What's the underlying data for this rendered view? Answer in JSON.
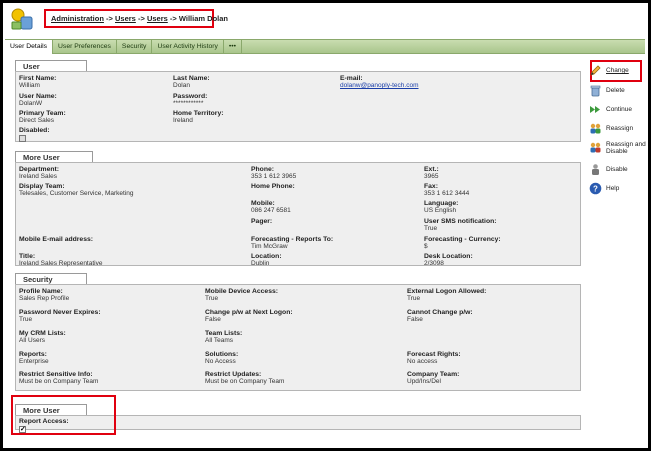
{
  "breadcrumb": {
    "items": [
      "Administration",
      "Users",
      "Users"
    ],
    "separator": "->",
    "current": "William Dolan"
  },
  "tabs": [
    "User Details",
    "User Preferences",
    "Security",
    "User Activity History",
    "•••"
  ],
  "user": {
    "title": "User",
    "first_name_label": "First Name:",
    "first_name": "William",
    "last_name_label": "Last Name:",
    "last_name": "Dolan",
    "email_label": "E-mail:",
    "email": "dolanw@panoply-tech.com",
    "username_label": "User Name:",
    "username": "DolanW",
    "password_label": "Password:",
    "password": "************",
    "primary_team_label": "Primary Team:",
    "primary_team": "Direct Sales",
    "home_territory_label": "Home Territory:",
    "home_territory": "Ireland",
    "disabled_label": "Disabled:"
  },
  "more_details": {
    "title": "More User Details",
    "department_label": "Department:",
    "department": "Ireland Sales",
    "phone_label": "Phone:",
    "phone": "353 1 612 3965",
    "ext_label": "Ext.:",
    "ext": "3965",
    "display_team_label": "Display Team:",
    "display_team": "Telesales, Customer Service, Marketing",
    "home_phone_label": "Home Phone:",
    "fax_label": "Fax:",
    "fax": "353 1 612 3444",
    "mobile_label": "Mobile:",
    "mobile": "086 247 6581",
    "language_label": "Language:",
    "language": "US English",
    "pager_label": "Pager:",
    "sms_label": "User SMS notification:",
    "sms": "True",
    "mobile_email_label": "Mobile E-mail address:",
    "forecast_reports_label": "Forecasting - Reports To:",
    "forecast_reports": "Tim McGraw",
    "forecast_currency_label": "Forecasting - Currency:",
    "forecast_currency": "$",
    "title_label": "Title:",
    "title_value": "Ireland Sales Representative",
    "location_label": "Location:",
    "location": "Dublin",
    "desk_label": "Desk Location:",
    "desk": "2/3098"
  },
  "security": {
    "title": "Security",
    "profile_label": "Profile Name:",
    "profile": "Sales Rep Profile",
    "mobile_access_label": "Mobile Device Access:",
    "mobile_access": "True",
    "ext_logon_label": "External Logon Allowed:",
    "ext_logon": "True",
    "pw_never_label": "Password Never Expires:",
    "pw_never": "True",
    "change_pw_label": "Change p/w at Next Logon:",
    "change_pw": "False",
    "cannot_change_label": "Cannot Change p/w:",
    "cannot_change": "False",
    "crm_lists_label": "My CRM Lists:",
    "crm_lists": "All Users",
    "team_lists_label": "Team Lists:",
    "team_lists": "All Teams",
    "reports_label": "Reports:",
    "reports": "Enterprise",
    "solutions_label": "Solutions:",
    "solutions": "No Access",
    "forecast_rights_label": "Forecast Rights:",
    "forecast_rights": "No access",
    "restrict_info_label": "Restrict Sensitive Info:",
    "restrict_info": "Must be on Company Team",
    "restrict_updates_label": "Restrict Updates:",
    "restrict_updates": "Must be on Company Team",
    "company_team_label": "Company Team:",
    "company_team": "Upd/Ins/Del"
  },
  "more_details2": {
    "title": "More User Details",
    "report_access_label": "Report Access:"
  },
  "actions": {
    "change": "Change",
    "delete": "Delete",
    "continue": "Continue",
    "reassign": "Reassign",
    "reassign_disable": "Reassign and Disable",
    "disable": "Disable",
    "help": "Help"
  }
}
